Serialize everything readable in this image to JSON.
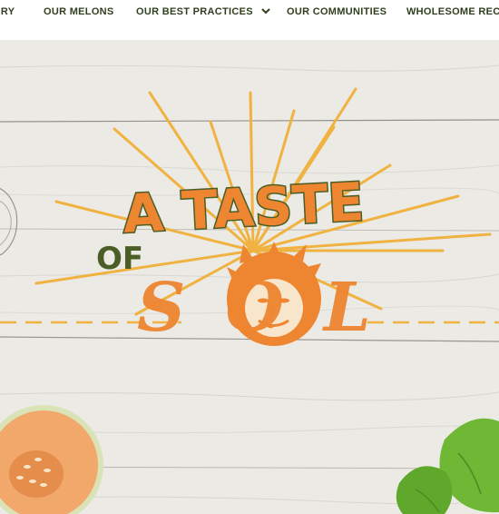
{
  "nav": {
    "items": [
      {
        "label": "ORY"
      },
      {
        "label": "OUR MELONS"
      },
      {
        "label": "OUR BEST PRACTICES"
      },
      {
        "label": "OUR COMMUNITIES"
      },
      {
        "label": "WHOLESOME RECIPES"
      }
    ],
    "chevron_icon": "chevron-down-icon"
  },
  "hero": {
    "logo": {
      "line1": "A TASTE",
      "line2": "OF",
      "line3": "SOL"
    },
    "colors": {
      "orange": "#ee8530",
      "dark_green": "#4a5e25",
      "rays": "#f0b240",
      "wood": "#ecebe6",
      "plank_line": "#7a7570"
    }
  }
}
